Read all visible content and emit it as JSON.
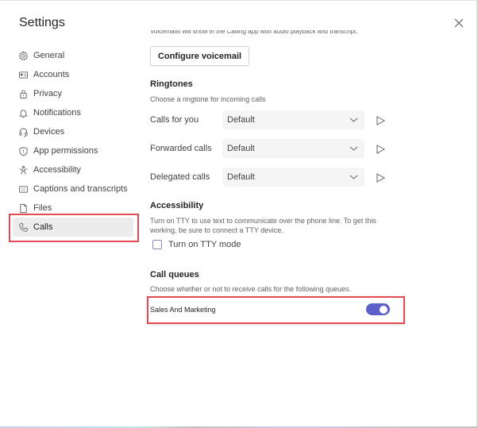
{
  "window": {
    "title": "Settings",
    "close_icon": "close-icon"
  },
  "sidebar": {
    "items": [
      {
        "label": "General",
        "icon": "gear-icon"
      },
      {
        "label": "Accounts",
        "icon": "id-card-icon"
      },
      {
        "label": "Privacy",
        "icon": "lock-icon"
      },
      {
        "label": "Notifications",
        "icon": "bell-icon"
      },
      {
        "label": "Devices",
        "icon": "headset-icon"
      },
      {
        "label": "App permissions",
        "icon": "shield-icon"
      },
      {
        "label": "Accessibility",
        "icon": "accessibility-icon"
      },
      {
        "label": "Captions and transcripts",
        "icon": "closed-captions-icon"
      },
      {
        "label": "Files",
        "icon": "file-icon"
      },
      {
        "label": "Calls",
        "icon": "phone-icon",
        "active": true
      }
    ]
  },
  "voicemail": {
    "description": "Voicemails will show in the Calling app with audio playback and transcript.",
    "configure_button": "Configure voicemail"
  },
  "ringtones": {
    "heading": "Ringtones",
    "description": "Choose a ringtone for incoming calls",
    "rows": [
      {
        "label": "Calls for you",
        "value": "Default"
      },
      {
        "label": "Forwarded calls",
        "value": "Default"
      },
      {
        "label": "Delegated calls",
        "value": "Default"
      }
    ]
  },
  "accessibility": {
    "heading": "Accessibility",
    "description_line1": "Turn on TTY to use text to communicate over the phone line. To get this",
    "description_line2": "working, be sure to connect a TTY device.",
    "tty_checkbox_label": "Turn on TTY mode",
    "tty_checked": false
  },
  "call_queues": {
    "heading": "Call queues",
    "description": "Choose whether or not to receive calls for the following queues.",
    "queues": [
      {
        "name": "Sales And Marketing",
        "enabled": true
      }
    ]
  },
  "colors": {
    "accent": "#5b5fc7",
    "highlight_box": "#e44a52",
    "active_nav_bg": "#ececec"
  }
}
